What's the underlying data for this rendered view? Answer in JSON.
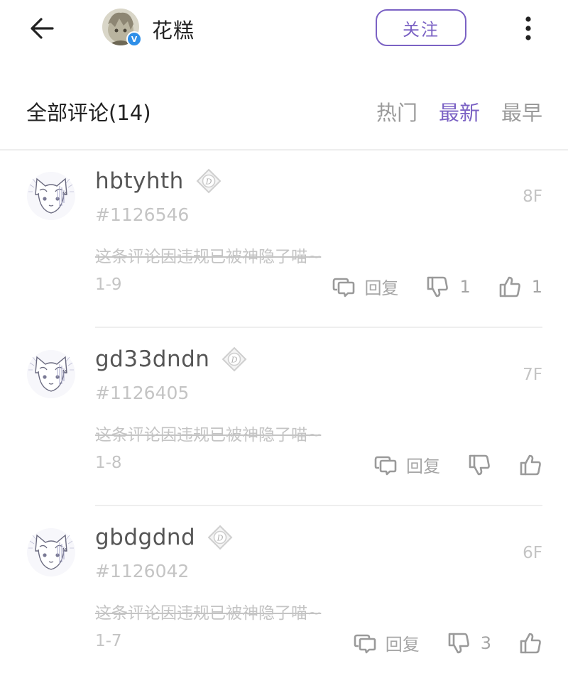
{
  "header": {
    "username": "花糕",
    "verified_mark": "V",
    "follow_label": "关注",
    "icons": {
      "back": "back-arrow-icon",
      "more": "more-vertical-icon"
    }
  },
  "comments_section": {
    "title": "全部评论(14)",
    "sort_tabs": [
      {
        "label": "热门",
        "active": false
      },
      {
        "label": "最新",
        "active": true
      },
      {
        "label": "最早",
        "active": false
      }
    ],
    "accent_color": "#7b62c4"
  },
  "comments": [
    {
      "name": "hbtyhth",
      "id": "#1126546",
      "floor": "8F",
      "text": "这条评论因违规已被神隐了喵~",
      "time": "1-9",
      "reply_label": "回复",
      "dislike_count": "1",
      "like_count": "1"
    },
    {
      "name": "gd33dndn",
      "id": "#1126405",
      "floor": "7F",
      "text": "这条评论因违规已被神隐了喵~",
      "time": "1-8",
      "reply_label": "回复",
      "dislike_count": "",
      "like_count": ""
    },
    {
      "name": "gbdgdnd",
      "id": "#1126042",
      "floor": "6F",
      "text": "这条评论因违规已被神隐了喵~",
      "time": "1-7",
      "reply_label": "回复",
      "dislike_count": "3",
      "like_count": ""
    }
  ]
}
